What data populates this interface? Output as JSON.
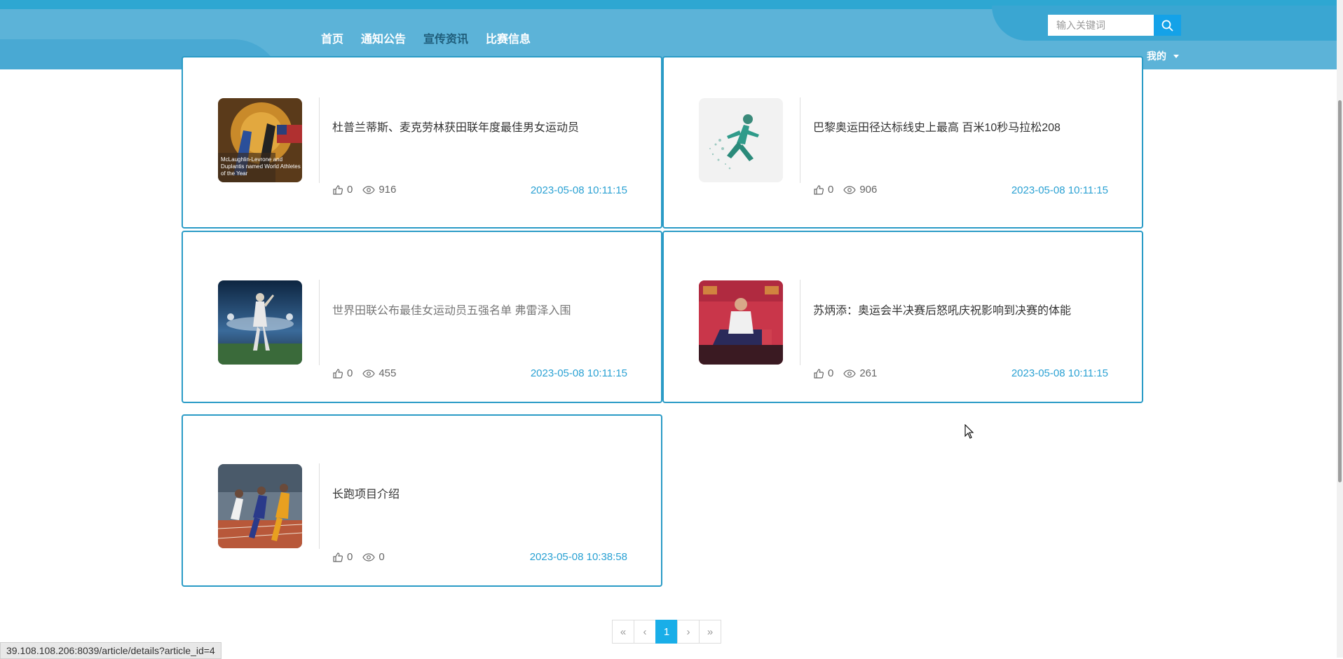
{
  "nav": {
    "items": [
      "首页",
      "通知公告",
      "宣传资讯",
      "比赛信息"
    ],
    "active_index": 2
  },
  "search": {
    "placeholder": "输入关键词"
  },
  "user_menu": {
    "label": "我的"
  },
  "articles": [
    {
      "title": "杜普兰蒂斯、麦克劳林获田联年度最佳男女运动员",
      "likes": "0",
      "views": "916",
      "date": "2023-05-08 10:11:15"
    },
    {
      "title": "巴黎奥运田径达标线史上最高 百米10秒马拉松208",
      "likes": "0",
      "views": "906",
      "date": "2023-05-08 10:11:15"
    },
    {
      "title": "世界田联公布最佳女运动员五强名单 弗雷泽入围",
      "likes": "0",
      "views": "455",
      "date": "2023-05-08 10:11:15"
    },
    {
      "title": "苏炳添：奥运会半决赛后怒吼庆祝影响到决赛的体能",
      "likes": "0",
      "views": "261",
      "date": "2023-05-08 10:11:15"
    },
    {
      "title": "长跑项目介绍",
      "likes": "0",
      "views": "0",
      "date": "2023-05-08 10:38:58"
    }
  ],
  "pagination": {
    "first": "«",
    "prev": "‹",
    "current": "1",
    "next": "›",
    "last": "»"
  },
  "status_url": "39.108.108.206:8039/article/details?article_id=4",
  "colors": {
    "header": "#5cb3d8",
    "accent": "#2aa1d3",
    "card_border": "#2a9bc6",
    "page_active": "#19aee8"
  },
  "icons": {
    "like": "thumbs-up-icon",
    "views": "eye-icon",
    "search": "search-icon"
  }
}
